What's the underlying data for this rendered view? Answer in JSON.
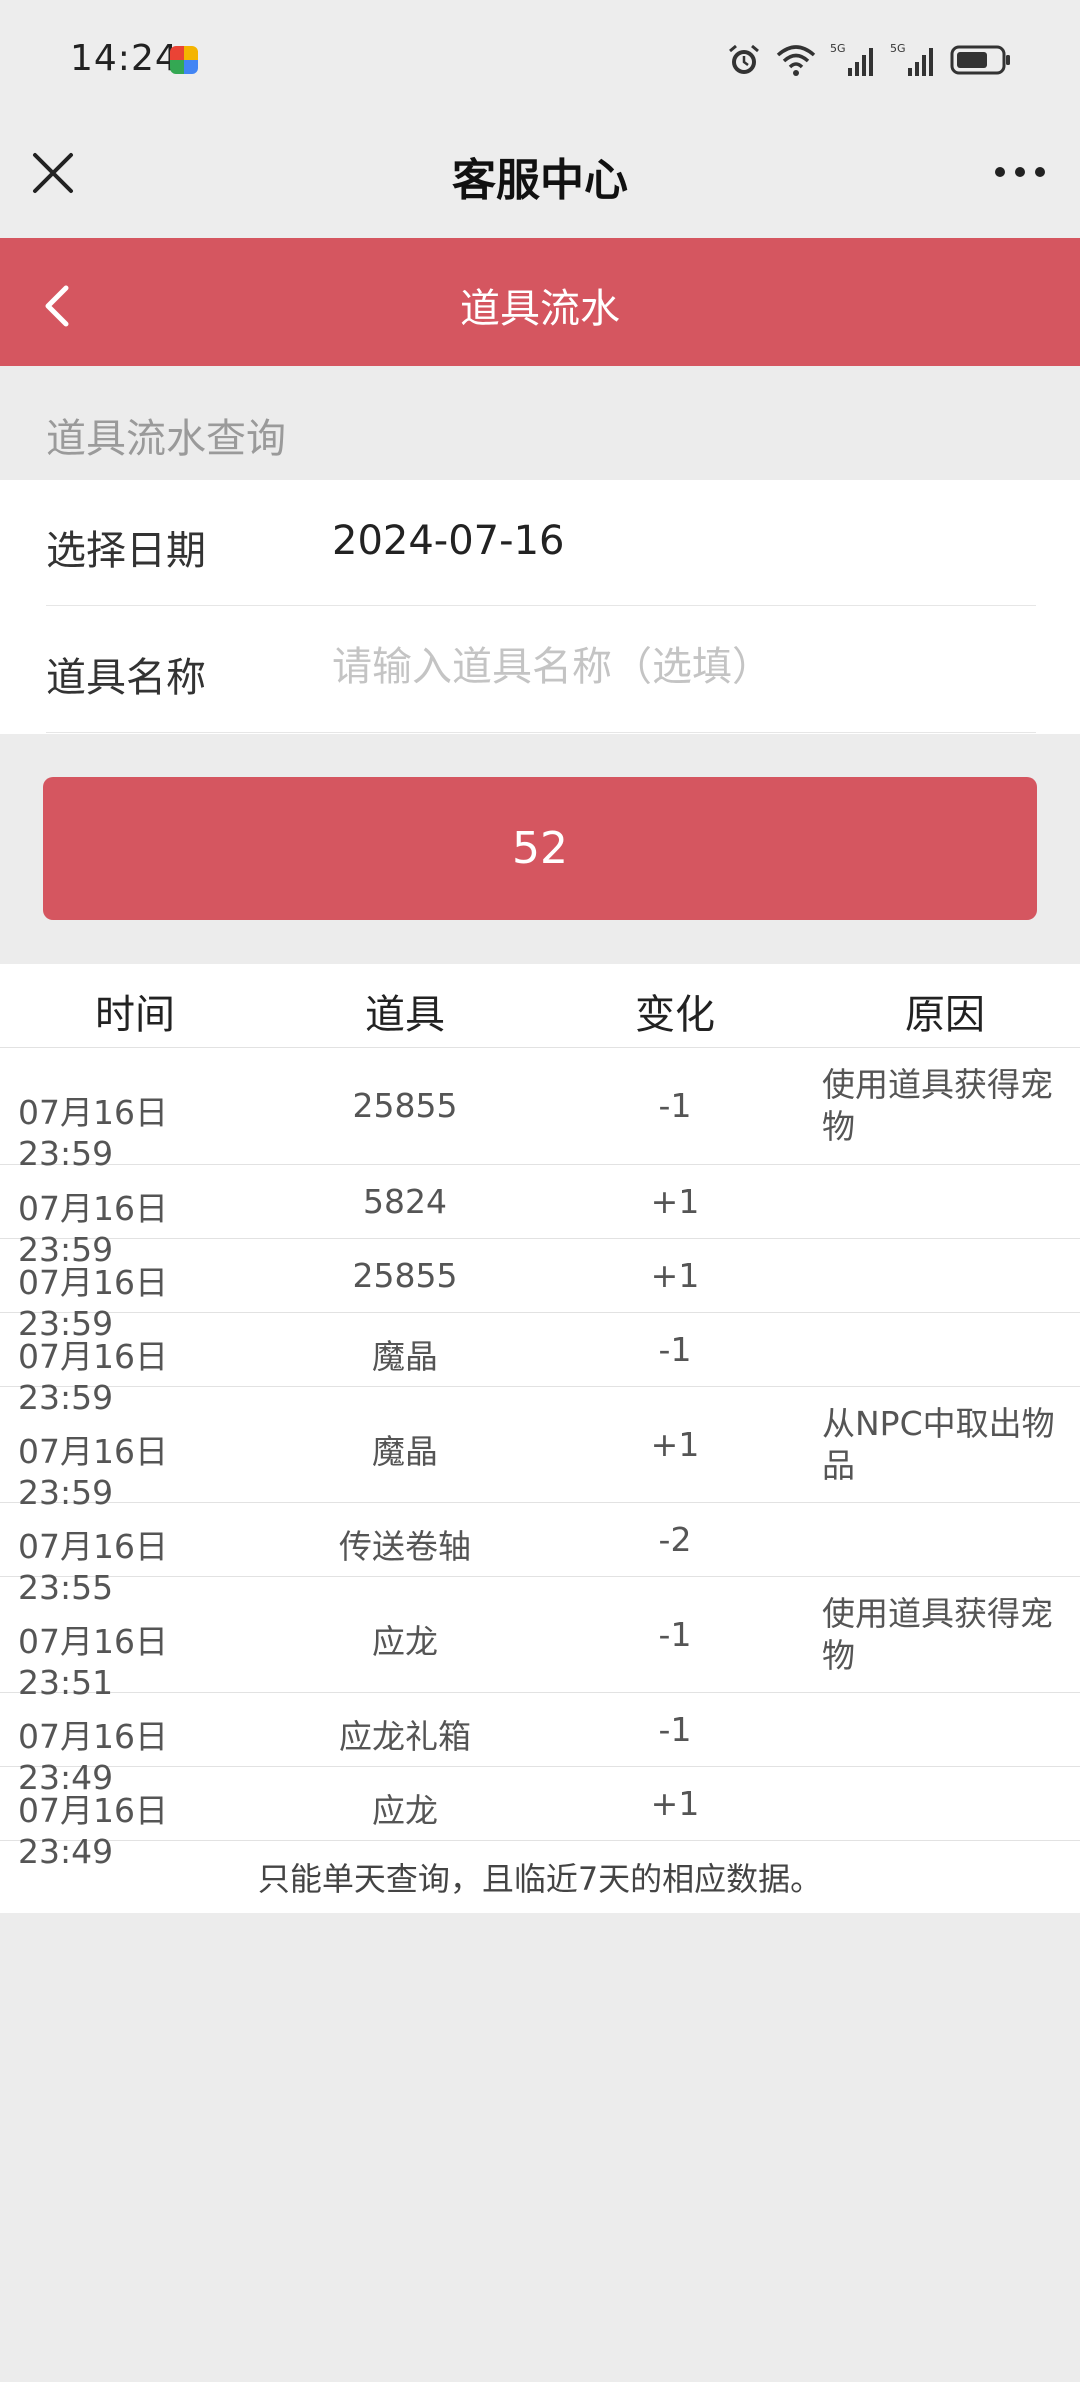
{
  "status_bar": {
    "time": "14:24",
    "icons": [
      "alarm-icon",
      "wifi-icon",
      "signal-5g-icon",
      "signal-5g-icon",
      "battery-icon"
    ],
    "network_label": "5G"
  },
  "header": {
    "title": "客服中心",
    "close_icon": "close-icon",
    "more_icon": "more-icon"
  },
  "nav": {
    "title": "道具流水",
    "back_icon": "chevron-left-icon",
    "accent_color": "#d55660"
  },
  "query": {
    "section_label": "道具流水查询",
    "date_label": "选择日期",
    "date_value": "2024-07-16",
    "item_label": "道具名称",
    "item_placeholder": "请输入道具名称（选填）",
    "button_label": "52"
  },
  "table": {
    "columns": [
      "时间",
      "道具",
      "变化",
      "原因"
    ],
    "rows": [
      {
        "time": "07月16日 23:59",
        "item": "25855",
        "change": "-1",
        "reason": "使用道具获得宠物"
      },
      {
        "time": "07月16日 23:59",
        "item": "5824",
        "change": "+1",
        "reason": ""
      },
      {
        "time": "07月16日 23:59",
        "item": "25855",
        "change": "+1",
        "reason": ""
      },
      {
        "time": "07月16日 23:59",
        "item": "魔晶",
        "change": "-1",
        "reason": ""
      },
      {
        "time": "07月16日 23:59",
        "item": "魔晶",
        "change": "+1",
        "reason": "从NPC中取出物品"
      },
      {
        "time": "07月16日 23:55",
        "item": "传送卷轴",
        "change": "-2",
        "reason": ""
      },
      {
        "time": "07月16日 23:51",
        "item": "应龙",
        "change": "-1",
        "reason": "使用道具获得宠物"
      },
      {
        "time": "07月16日 23:49",
        "item": "应龙礼箱",
        "change": "-1",
        "reason": ""
      },
      {
        "time": "07月16日 23:49",
        "item": "应龙",
        "change": "+1",
        "reason": ""
      }
    ],
    "footnote": "只能单天查询，且临近7天的相应数据。"
  }
}
